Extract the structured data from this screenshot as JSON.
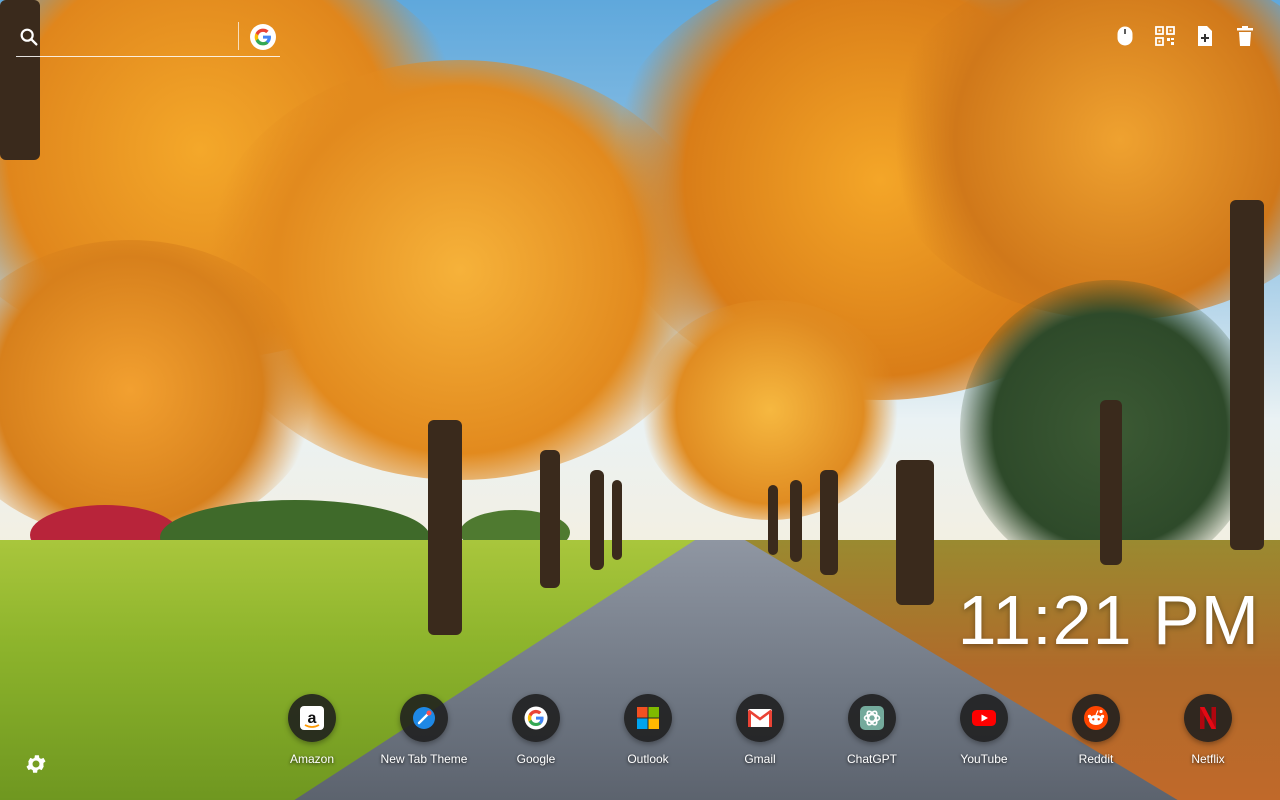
{
  "search": {
    "placeholder": "",
    "engine_icon": "google-icon"
  },
  "toolbar": {
    "items": [
      {
        "name": "mouse-icon"
      },
      {
        "name": "qr-code-icon"
      },
      {
        "name": "add-page-icon"
      },
      {
        "name": "trash-icon"
      }
    ]
  },
  "clock": {
    "time": "11:21 PM"
  },
  "shortcuts": [
    {
      "label": "Amazon",
      "icon": "amazon-icon"
    },
    {
      "label": "New Tab Theme",
      "icon": "new-tab-theme-icon"
    },
    {
      "label": "Google",
      "icon": "google-icon"
    },
    {
      "label": "Outlook",
      "icon": "outlook-icon"
    },
    {
      "label": "Gmail",
      "icon": "gmail-icon"
    },
    {
      "label": "ChatGPT",
      "icon": "chatgpt-icon"
    },
    {
      "label": "YouTube",
      "icon": "youtube-icon"
    },
    {
      "label": "Reddit",
      "icon": "reddit-icon"
    },
    {
      "label": "Netflix",
      "icon": "netflix-icon"
    }
  ],
  "settings": {
    "icon": "gear-icon"
  },
  "colors": {
    "accent_text": "#ffffff",
    "shortcut_bg": "#1e1e1e",
    "foliage": "#e8901a"
  }
}
